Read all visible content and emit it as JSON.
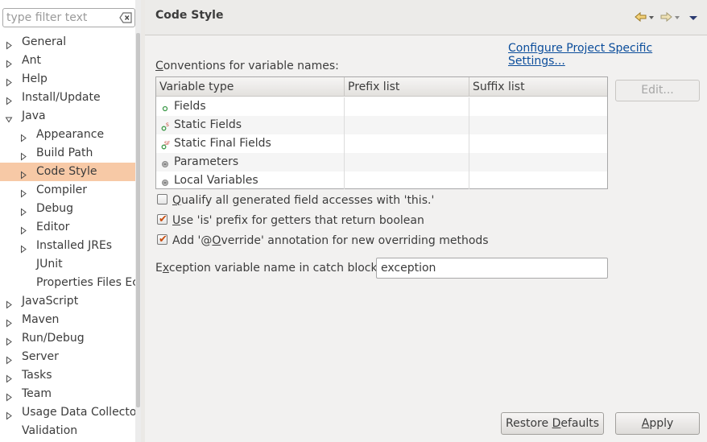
{
  "filter": {
    "placeholder": "type filter text"
  },
  "tree": [
    {
      "label": "General",
      "level": 0,
      "arrow": "right"
    },
    {
      "label": "Ant",
      "level": 0,
      "arrow": "right"
    },
    {
      "label": "Help",
      "level": 0,
      "arrow": "right"
    },
    {
      "label": "Install/Update",
      "level": 0,
      "arrow": "right"
    },
    {
      "label": "Java",
      "level": 0,
      "arrow": "down"
    },
    {
      "label": "Appearance",
      "level": 1,
      "arrow": "right"
    },
    {
      "label": "Build Path",
      "level": 1,
      "arrow": "right"
    },
    {
      "label": "Code Style",
      "level": 1,
      "arrow": "right",
      "selected": true
    },
    {
      "label": "Compiler",
      "level": 1,
      "arrow": "right"
    },
    {
      "label": "Debug",
      "level": 1,
      "arrow": "right"
    },
    {
      "label": "Editor",
      "level": 1,
      "arrow": "right"
    },
    {
      "label": "Installed JREs",
      "level": 1,
      "arrow": "right"
    },
    {
      "label": "JUnit",
      "level": 1,
      "arrow": "none"
    },
    {
      "label": "Properties Files Ec",
      "level": 1,
      "arrow": "none"
    },
    {
      "label": "JavaScript",
      "level": 0,
      "arrow": "right"
    },
    {
      "label": "Maven",
      "level": 0,
      "arrow": "right"
    },
    {
      "label": "Run/Debug",
      "level": 0,
      "arrow": "right"
    },
    {
      "label": "Server",
      "level": 0,
      "arrow": "right"
    },
    {
      "label": "Tasks",
      "level": 0,
      "arrow": "right"
    },
    {
      "label": "Team",
      "level": 0,
      "arrow": "right"
    },
    {
      "label": "Usage Data Collector",
      "level": 0,
      "arrow": "right"
    },
    {
      "label": "Validation",
      "level": 0,
      "arrow": "none"
    }
  ],
  "header": {
    "title": "Code Style"
  },
  "main": {
    "config_link": "Configure Project Specific Settings...",
    "conventions_label": "Conventions for variable names:",
    "table": {
      "columns": [
        "Variable type",
        "Prefix list",
        "Suffix list"
      ],
      "rows": [
        {
          "name": "Fields",
          "icon": "field-icon",
          "prefix": "",
          "suffix": ""
        },
        {
          "name": "Static Fields",
          "icon": "static-field-icon",
          "prefix": "",
          "suffix": ""
        },
        {
          "name": "Static Final Fields",
          "icon": "static-final-field-icon",
          "prefix": "",
          "suffix": ""
        },
        {
          "name": "Parameters",
          "icon": "parameter-icon",
          "prefix": "",
          "suffix": ""
        },
        {
          "name": "Local Variables",
          "icon": "local-variable-icon",
          "prefix": "",
          "suffix": ""
        }
      ]
    },
    "edit_button": "Edit...",
    "checks": [
      {
        "label": "Qualify all generated field accesses with 'this.'",
        "checked": false
      },
      {
        "label": "Use 'is' prefix for getters that return boolean",
        "checked": true
      },
      {
        "label": "Add '@Override' annotation for new overriding methods",
        "checked": true
      }
    ],
    "exception_label": "Exception variable name in catch blocks:",
    "exception_value": "exception"
  },
  "buttons": {
    "restore": "Restore Defaults",
    "apply": "Apply"
  },
  "colors": {
    "selection": "#f7c9a6",
    "link": "#0b4d9b",
    "check": "#c84d0f"
  }
}
